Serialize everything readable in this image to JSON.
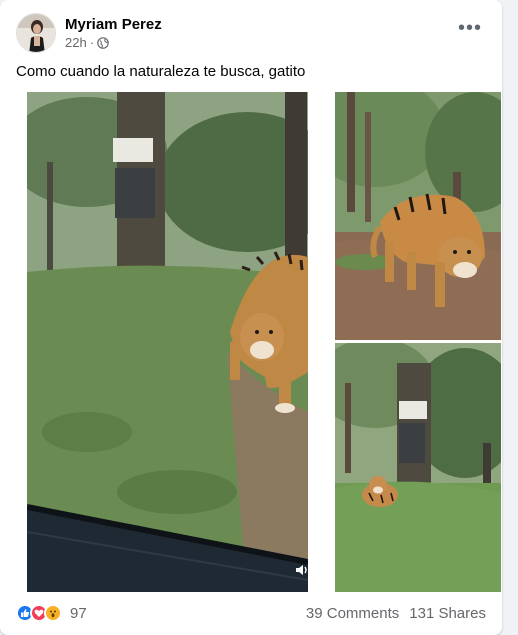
{
  "post": {
    "author": "Myriam Perez",
    "time": "22h",
    "caption": "Como cuando la naturaleza te busca, gatito"
  },
  "icons": {
    "avatar": "avatar",
    "privacy": "globe-icon",
    "more": "more-options-icon",
    "volume": "volume-icon"
  },
  "reactions": {
    "count": "97",
    "types": [
      "like",
      "love",
      "wow"
    ]
  },
  "stats": {
    "comments": "39 Comments",
    "shares": "131 Shares"
  },
  "colors": {
    "accent": "#1877f2",
    "secondary_text": "#65676b"
  }
}
